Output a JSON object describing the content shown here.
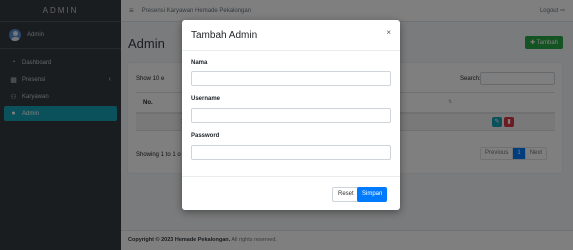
{
  "sidebar": {
    "brand": "ADMIN",
    "user_name": "Admin",
    "items": [
      {
        "label": "Dashboard",
        "icon": "gauge-icon"
      },
      {
        "label": "Presensi",
        "icon": "table-icon"
      },
      {
        "label": "Karyawan",
        "icon": "users-icon"
      },
      {
        "label": "Admin",
        "icon": "user-shield-icon"
      }
    ],
    "active_color": "#17a2b8"
  },
  "topbar": {
    "hamburger": "≡",
    "title": "Presensi Karyawan Hemade Pekalongan",
    "logout": "Logout ⇨"
  },
  "main": {
    "page_title": "Admin",
    "add_button": "✚ Tambah",
    "show_text": "Show  10  e",
    "search_label": "Search:",
    "table_header_no": "No.",
    "table_header_mark": "⇅",
    "row_no": "1",
    "info_text": "Showing 1 to 1 o",
    "pager": {
      "previous": "Previous",
      "current": "1",
      "next": "Next"
    }
  },
  "footer": {
    "copyright": "Copyright © 2023 Hemade Pekalongan.",
    "rights": " All rights reserved."
  },
  "modal": {
    "title": "Tambah Admin",
    "close": "×",
    "fields": [
      {
        "label": "Nama",
        "value": ""
      },
      {
        "label": "Username",
        "value": ""
      },
      {
        "label": "Password",
        "value": ""
      }
    ],
    "reset_label": "Reset",
    "save_label": "Simpan"
  },
  "colors": {
    "success": "#28a745",
    "primary": "#007bff",
    "danger": "#dc3545",
    "sidebar": "#343a40"
  }
}
